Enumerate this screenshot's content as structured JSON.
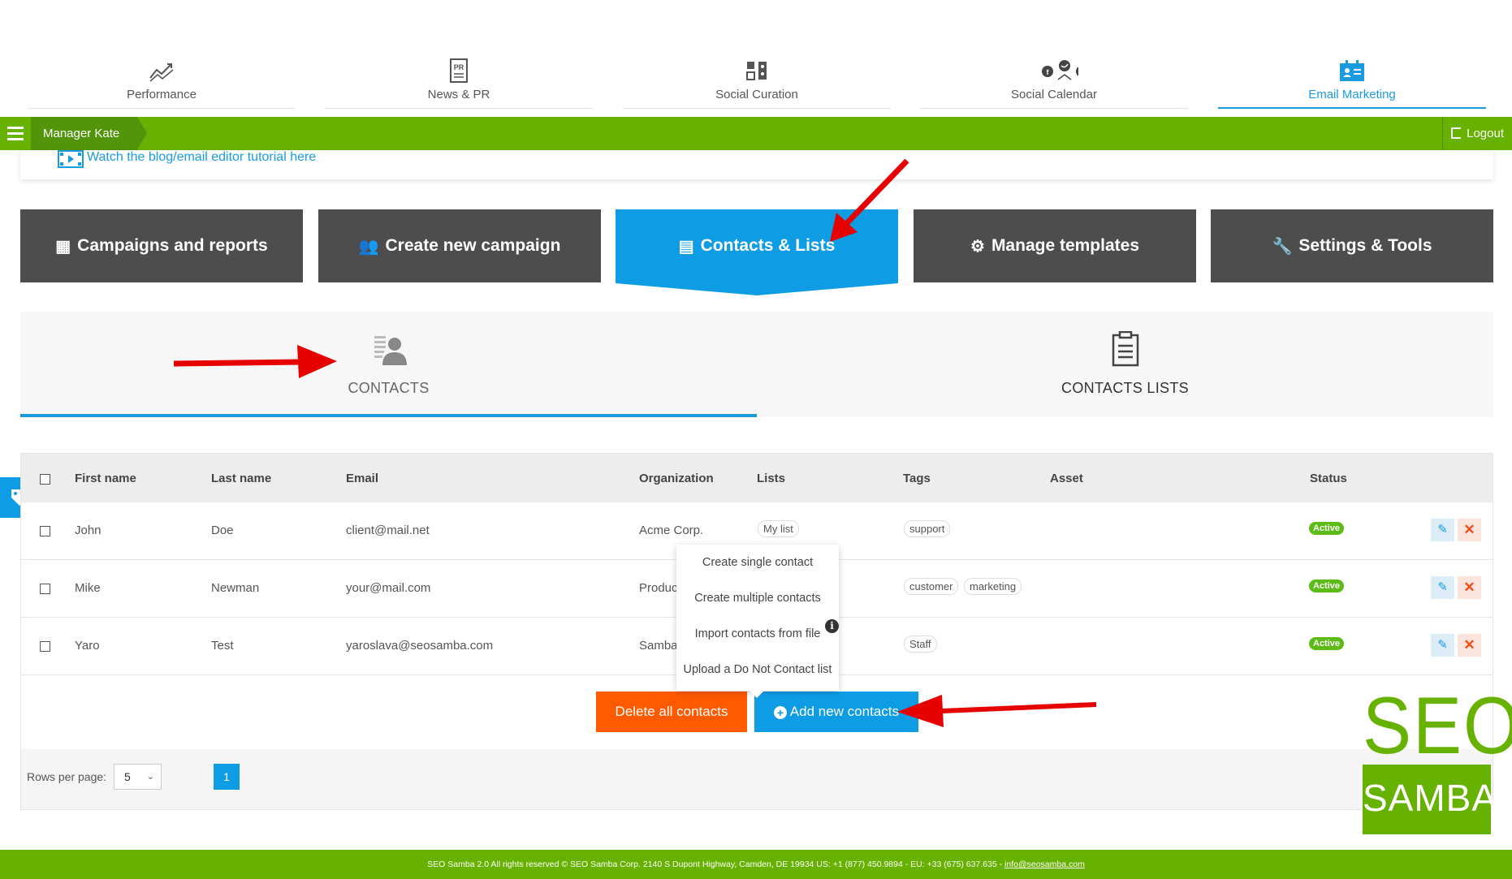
{
  "topnav": {
    "items": [
      {
        "label": "Performance",
        "icon": "chart-trend-icon"
      },
      {
        "label": "News & PR",
        "icon": "pr-document-icon"
      },
      {
        "label": "Social Curation",
        "icon": "social-curation-icon"
      },
      {
        "label": "Social Calendar",
        "icon": "social-networks-icon"
      },
      {
        "label": "Email Marketing",
        "icon": "email-contact-card-icon"
      }
    ],
    "active": "Email Marketing"
  },
  "greenbar": {
    "breadcrumb": "Manager Kate",
    "logout": "Logout"
  },
  "tutorial": {
    "link_text": "Watch the blog/email editor tutorial here"
  },
  "main_tabs": [
    {
      "label": "Campaigns and reports",
      "icon": "campaigns-icon"
    },
    {
      "label": "Create new campaign",
      "icon": "users-icon"
    },
    {
      "label": "Contacts & Lists",
      "icon": "address-book-icon"
    },
    {
      "label": "Manage templates",
      "icon": "gear-icon"
    },
    {
      "label": "Settings & Tools",
      "icon": "wrench-icon"
    }
  ],
  "sub_tabs": [
    {
      "label": "CONTACTS",
      "icon": "contacts-icon"
    },
    {
      "label": "CONTACTS LISTS",
      "icon": "clipboard-list-icon"
    }
  ],
  "table": {
    "headers": {
      "first_name": "First name",
      "last_name": "Last name",
      "email": "Email",
      "organization": "Organization",
      "lists": "Lists",
      "tags": "Tags",
      "asset": "Asset",
      "status": "Status"
    },
    "rows": [
      {
        "first_name": "John",
        "last_name": "Doe",
        "email": "client@mail.net",
        "organization": "Acme Corp.",
        "lists": [
          "My list"
        ],
        "tags": [
          "support"
        ],
        "status": "Active"
      },
      {
        "first_name": "Mike",
        "last_name": "Newman",
        "email": "your@mail.com",
        "organization": "Produc",
        "lists": [],
        "tags": [
          "customer",
          "marketing"
        ],
        "status": "Active"
      },
      {
        "first_name": "Yaro",
        "last_name": "Test",
        "email": "yaroslava@seosamba.com",
        "organization": "Samba",
        "lists": [],
        "tags": [
          "Staff"
        ],
        "status": "Active"
      }
    ]
  },
  "popup_menu": [
    "Create single contact",
    "Create multiple contacts",
    "Import contacts from file",
    "Upload a Do Not Contact list"
  ],
  "actions": {
    "delete_all": "Delete all contacts",
    "add_new": "Add new contacts"
  },
  "pagination": {
    "rows_per_page_label": "Rows per page:",
    "rows_per_page_value": "5",
    "current_page": "1"
  },
  "logo": {
    "top": "SEO",
    "bottom": "SAMBA"
  },
  "footer": {
    "text": "SEO Samba 2.0  All rights reserved © SEO Samba Corp. 2140 S Dupont Highway, Camden, DE 19934 US: +1 (877) 450.9894 - EU: +33 (675) 637.635 - ",
    "email": "info@seosamba.com"
  },
  "colors": {
    "green": "#67b200",
    "blue": "#0e9de5",
    "dark_tab": "#4d4d4d",
    "orange": "#ff5a00",
    "arrow_red": "#e60000"
  }
}
